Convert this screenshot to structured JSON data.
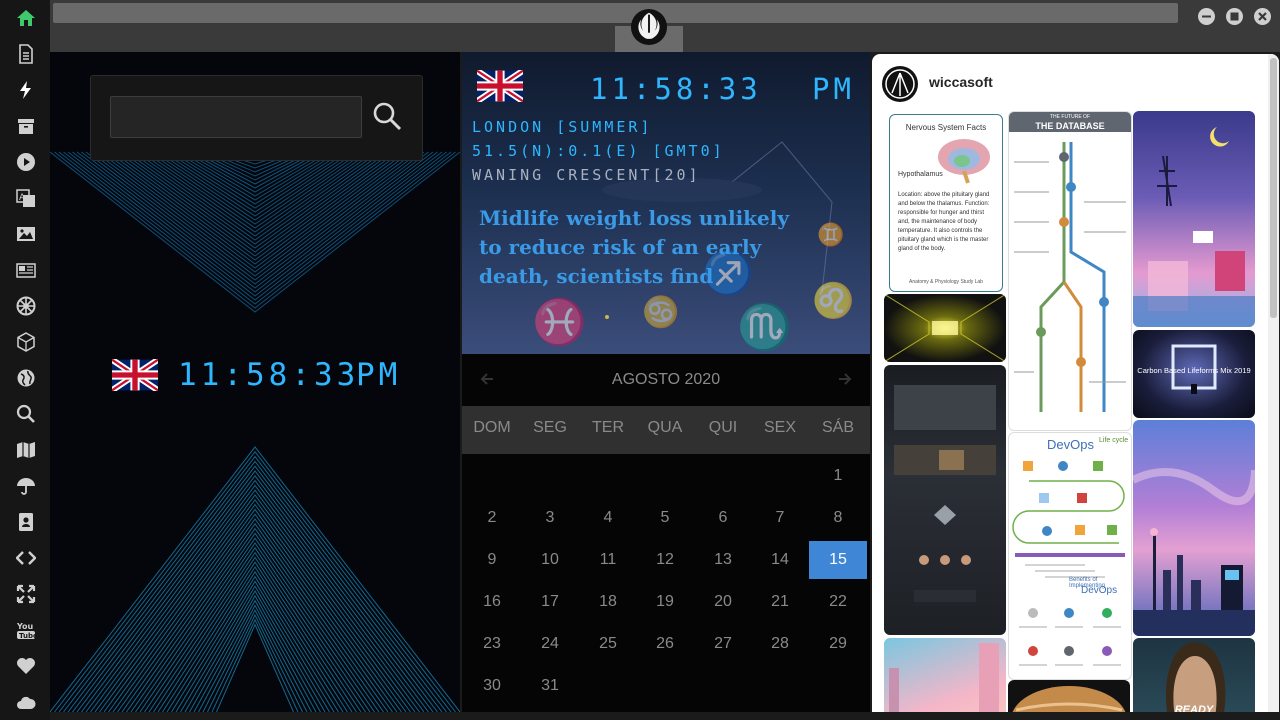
{
  "sidebar": {
    "items": [
      "home-icon",
      "document-icon",
      "bolt-icon",
      "archive-icon",
      "play-icon",
      "translate-icon",
      "image-icon",
      "news-icon",
      "empire-icon",
      "cube-icon",
      "globe-icon",
      "search-icon",
      "map-icon",
      "umbrella-icon",
      "contacts-icon",
      "code-icon",
      "expand-icon",
      "youtube-icon",
      "heart-icon",
      "cloud-icon"
    ]
  },
  "left_clock": {
    "time": "11:58:33",
    "ampm": "PM"
  },
  "banner": {
    "time": "11:58:33",
    "ampm": "PM",
    "location": "LONDON [SUMMER]",
    "coords": "51.5(N):0.1(E) [GMT0]",
    "moon": "WANING CRESCENT[20]",
    "headline": "Midlife weight loss unlikely to reduce risk of an early death, scientists find"
  },
  "calendar": {
    "month_label": "AGOSTO 2020",
    "weekdays": [
      "DOM",
      "SEG",
      "TER",
      "QUA",
      "QUI",
      "SEX",
      "SÁB"
    ],
    "selected": 15,
    "weeks": [
      [
        "",
        "",
        "",
        "",
        "",
        "",
        "1"
      ],
      [
        "2",
        "3",
        "4",
        "5",
        "6",
        "7",
        "8"
      ],
      [
        "9",
        "10",
        "11",
        "12",
        "13",
        "14",
        "15"
      ],
      [
        "16",
        "17",
        "18",
        "19",
        "20",
        "21",
        "22"
      ],
      [
        "23",
        "24",
        "25",
        "26",
        "27",
        "28",
        "29"
      ],
      [
        "30",
        "31",
        "",
        "",
        "",
        "",
        ""
      ]
    ]
  },
  "feed": {
    "username": "wiccasoft",
    "nervous_title": "Nervous System Facts",
    "nervous_label": "Hypothalamus",
    "nervous_text": "Location: above the pituitary gland and below the thalamus. Function: responsible for hunger and thirst and, the maintenance of body temperature. It also controls the pituitary gland which is the master gland of the body.",
    "nervous_footer": "Anatomy & Physiology Study Lab",
    "db_title_small": "THE FUTURE OF",
    "db_title": "THE DATABASE",
    "devops_title": "DevOps",
    "devops_subtitle": "Life cycle",
    "devops_benefits": "Benefits of Implementing",
    "devops_benefits2": "DevOps",
    "carbon_title": "Carbon Based Lifeforms Mix 2019",
    "poster_text": "READY"
  },
  "colors": {
    "accent": "#2eb6ff",
    "headline": "#3a9ae6",
    "selected_day": "#3f86d6"
  }
}
